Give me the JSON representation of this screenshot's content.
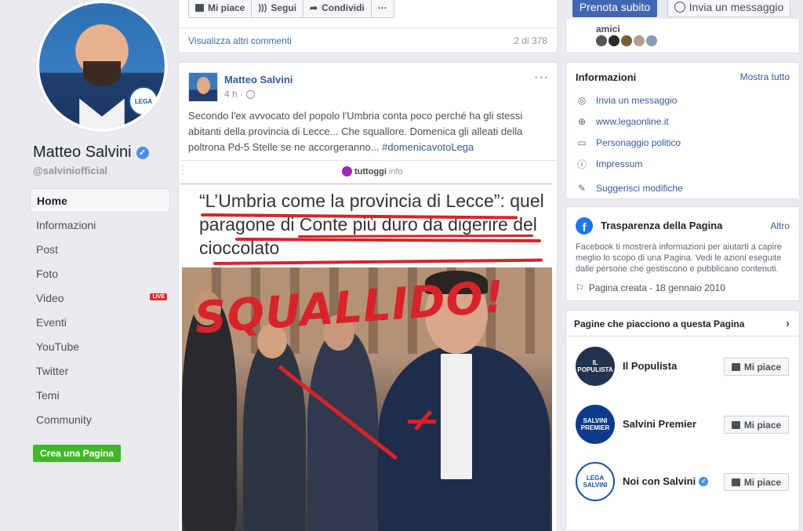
{
  "profile": {
    "name": "Matteo Salvini",
    "handle": "@salviniofficial",
    "logo_text": "LEGA"
  },
  "nav": {
    "items": [
      {
        "label": "Home",
        "active": true
      },
      {
        "label": "Informazioni"
      },
      {
        "label": "Post"
      },
      {
        "label": "Foto"
      },
      {
        "label": "Video",
        "badge": "LIVE"
      },
      {
        "label": "Eventi"
      },
      {
        "label": "YouTube"
      },
      {
        "label": "Twitter"
      },
      {
        "label": "Temi"
      },
      {
        "label": "Community"
      }
    ],
    "create_page": "Crea una Pagina"
  },
  "top_post": {
    "actions": [
      "Mi piace",
      "Segui",
      "Condividi",
      "···"
    ],
    "view_comments": "Visualizza altri commenti",
    "comment_count": "2 di 378"
  },
  "post": {
    "author": "Matteo Salvini",
    "time": "4 h ·",
    "more": "···",
    "text": "Secondo l'ex avvocato del popolo l'Umbria conta poco perché ha gli stessi abitanti della provincia di Lecce... Che squallore. Domenica gli alleati della poltrona Pd-5 Stelle se ne accorgeranno... ",
    "hashtag": "#domenicavotoLega",
    "image": {
      "source": "tuttoggi",
      "source_suffix": "info",
      "headline": "“L’Umbria come la provincia di Lecce”: quel paragone di Conte più duro da digerire del cioccolato",
      "overlay_text": "SQUALLIDO!"
    }
  },
  "header_buttons": {
    "book": "Prenota subito",
    "message": "Invia un messaggio"
  },
  "friends": {
    "label": "amici"
  },
  "info": {
    "title": "Informazioni",
    "link": "Mostra tutto",
    "rows": [
      {
        "icon": "messenger-icon",
        "label": "Invia un messaggio"
      },
      {
        "icon": "globe-icon",
        "label": "www.legaonline.it"
      },
      {
        "icon": "category-icon",
        "label": "Personaggio politico"
      },
      {
        "icon": "info-icon",
        "label": "Impressum"
      },
      {
        "icon": "pencil-icon",
        "label": "Suggerisci modifiche"
      }
    ]
  },
  "transparency": {
    "title": "Trasparenza della Pagina",
    "link": "Altro",
    "description": "Facebook ti mostrerà informazioni per aiutarti a capire meglio lo scopo di una Pagina. Vedi le azioni eseguite dalle persone che gestiscono e pubblicano contenuti.",
    "created": "Pagina creata - 18 gennaio 2010"
  },
  "liked_pages": {
    "title": "Pagine che piacciono a questa Pagina",
    "like_label": "Mi piace",
    "pages": [
      {
        "name": "Il Populista",
        "avatar_text": "IL POPULISTA",
        "verified": false
      },
      {
        "name": "Salvini Premier",
        "avatar_text": "SALVINI PREMIER",
        "verified": false
      },
      {
        "name": "Noi con Salvini",
        "avatar_text": "LEGA SALVINI",
        "verified": true
      }
    ]
  },
  "colors": {
    "fb_blue": "#4267b2",
    "link": "#365899",
    "green": "#42b72a",
    "red_marker": "#d8232a"
  }
}
